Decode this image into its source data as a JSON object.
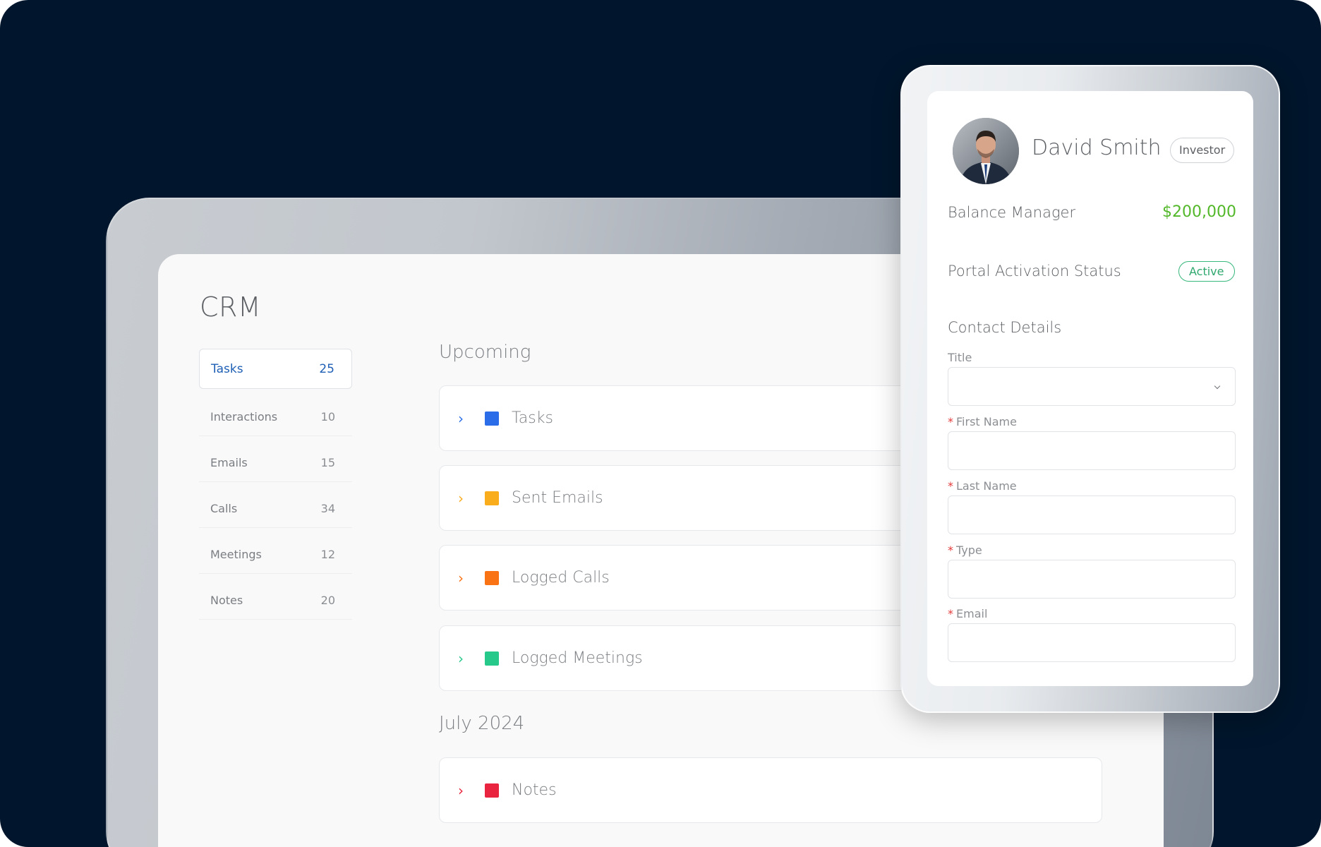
{
  "app": {
    "title": "CRM"
  },
  "sidebar": {
    "items": [
      {
        "label": "Tasks",
        "count": "25",
        "active": true
      },
      {
        "label": "Interactions",
        "count": "10"
      },
      {
        "label": "Emails",
        "count": "15"
      },
      {
        "label": "Calls",
        "count": "34"
      },
      {
        "label": "Meetings",
        "count": "12"
      },
      {
        "label": "Notes",
        "count": "20"
      }
    ]
  },
  "timeline": {
    "upcoming_title": "Upcoming",
    "upcoming": [
      {
        "label": "Tasks",
        "color": "#2b6de8"
      },
      {
        "label": "Sent Emails",
        "color": "#f9ac1c"
      },
      {
        "label": "Logged Calls",
        "color": "#f97314"
      },
      {
        "label": "Logged Meetings",
        "color": "#27c98a"
      }
    ],
    "month_title": "July 2024",
    "month": [
      {
        "label": "Notes",
        "color": "#e8243e"
      }
    ]
  },
  "contact_card": {
    "name": "David Smith",
    "badge": "Investor",
    "balance_label": "Balance Manager",
    "balance_value": "$200,000",
    "status_label": "Portal Activation Status",
    "status_value": "Active",
    "details_title": "Contact Details",
    "fields": [
      {
        "label": "Title",
        "required": false,
        "type": "select"
      },
      {
        "label": "First Name",
        "required": true
      },
      {
        "label": "Last Name",
        "required": true
      },
      {
        "label": "Type",
        "required": true
      },
      {
        "label": "Email",
        "required": true
      }
    ],
    "required_mark": "*"
  },
  "icons": {
    "chevron": "chevron-right-icon",
    "select_arrow": "chevron-down-icon"
  }
}
